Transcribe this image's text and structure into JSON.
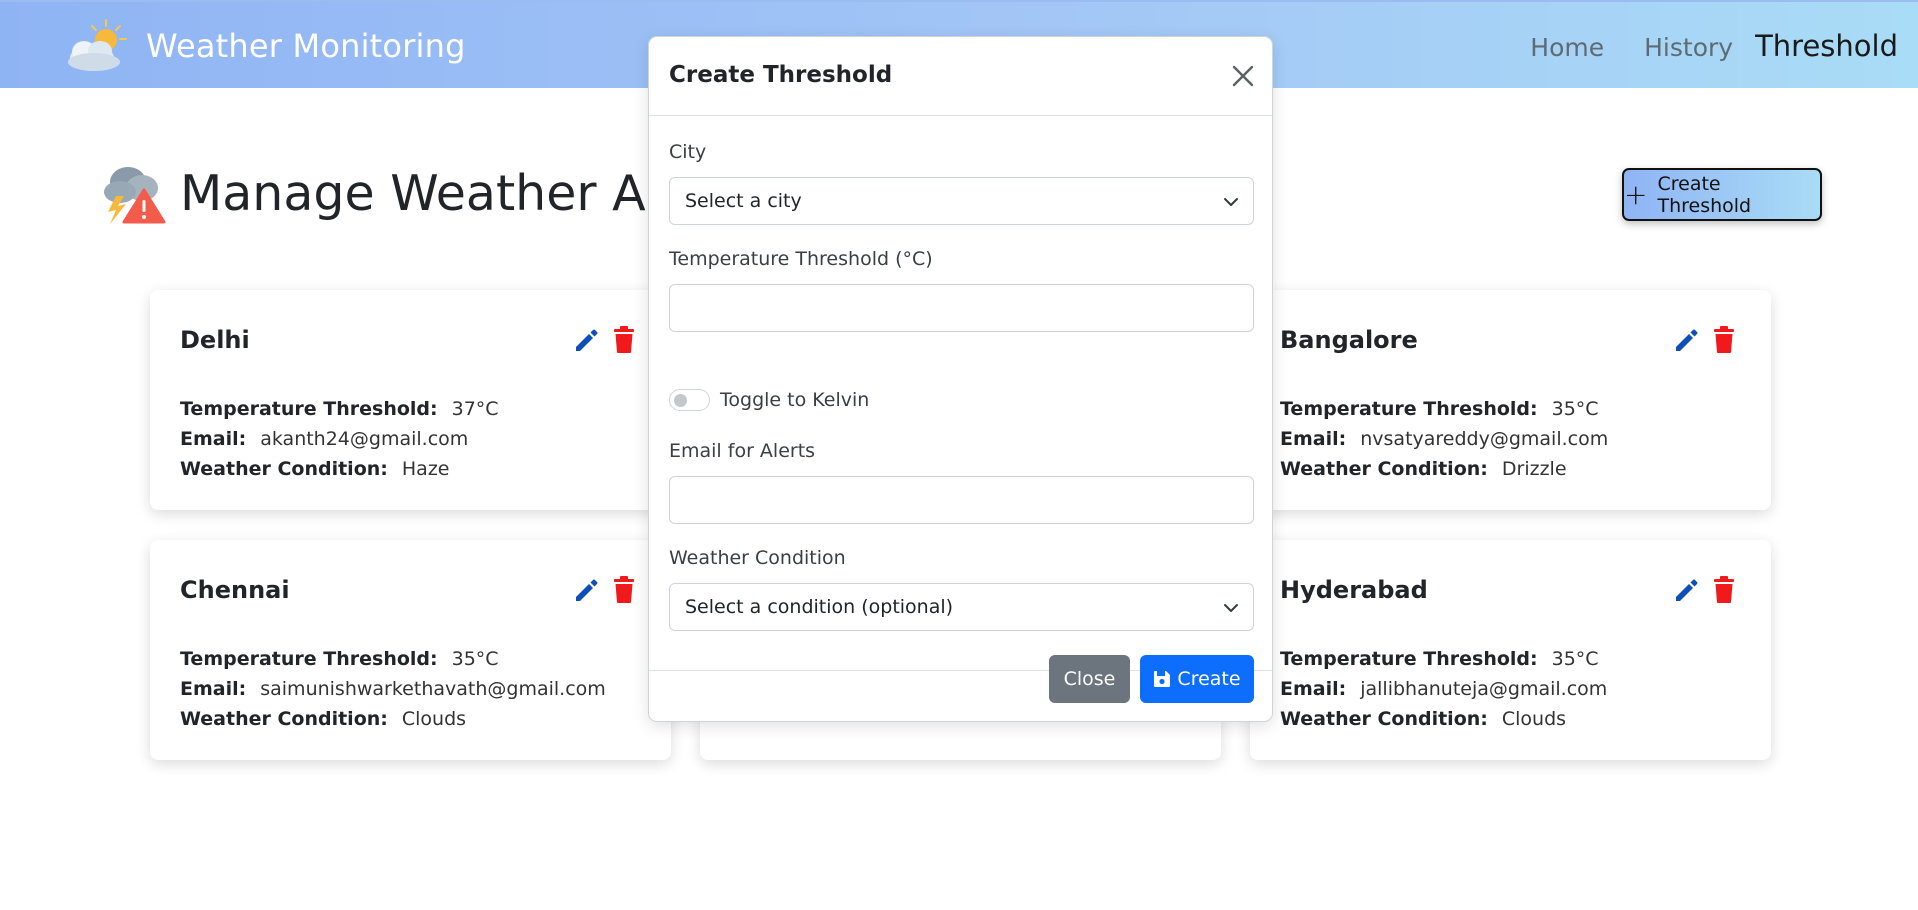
{
  "navbar": {
    "brand": "Weather Monitoring",
    "links": [
      "Home",
      "History",
      "Threshold"
    ],
    "active": "Threshold"
  },
  "page": {
    "title": "Manage Weather Alerts",
    "create_button": "Create Threshold"
  },
  "card_labels": {
    "temp": "Temperature Threshold:",
    "email": "Email:",
    "condition": "Weather Condition:"
  },
  "cards": [
    {
      "city": "Delhi",
      "temp": "37°C",
      "email": "akanth24@gmail.com",
      "condition": "Haze"
    },
    {
      "city": "Bangalore",
      "temp": "35°C",
      "email": "nvsatyareddy@gmail.com",
      "condition": "Drizzle"
    },
    {
      "city": "Chennai",
      "temp": "35°C",
      "email": "saimunishwarkethavath@gmail.com",
      "condition": "Clouds"
    },
    {
      "city": "Hyderabad",
      "temp": "35°C",
      "email": "jallibhanuteja@gmail.com",
      "condition": "Clouds"
    }
  ],
  "modal": {
    "title": "Create Threshold",
    "city_label": "City",
    "city_placeholder": "Select a city",
    "temp_label": "Temperature Threshold (°C)",
    "temp_value": "",
    "toggle_label": "Toggle to Kelvin",
    "email_label": "Email for Alerts",
    "email_value": "",
    "condition_label": "Weather Condition",
    "condition_placeholder": "Select a condition (optional)",
    "close_button": "Close",
    "create_button": "Create"
  },
  "colors": {
    "primary": "#0d6efd",
    "secondary": "#6c757d",
    "edit_icon": "#0d4fb8",
    "delete_icon": "#f0191b",
    "navbar_gradient_start": "#8fb4f4",
    "navbar_gradient_end": "#a9dcf6"
  },
  "icons": {
    "brand": "partly-cloudy-icon",
    "title": "storm-warning-icon",
    "edit": "pencil-icon",
    "delete": "trash-icon",
    "close": "close-icon",
    "save": "floppy-disk-icon"
  }
}
